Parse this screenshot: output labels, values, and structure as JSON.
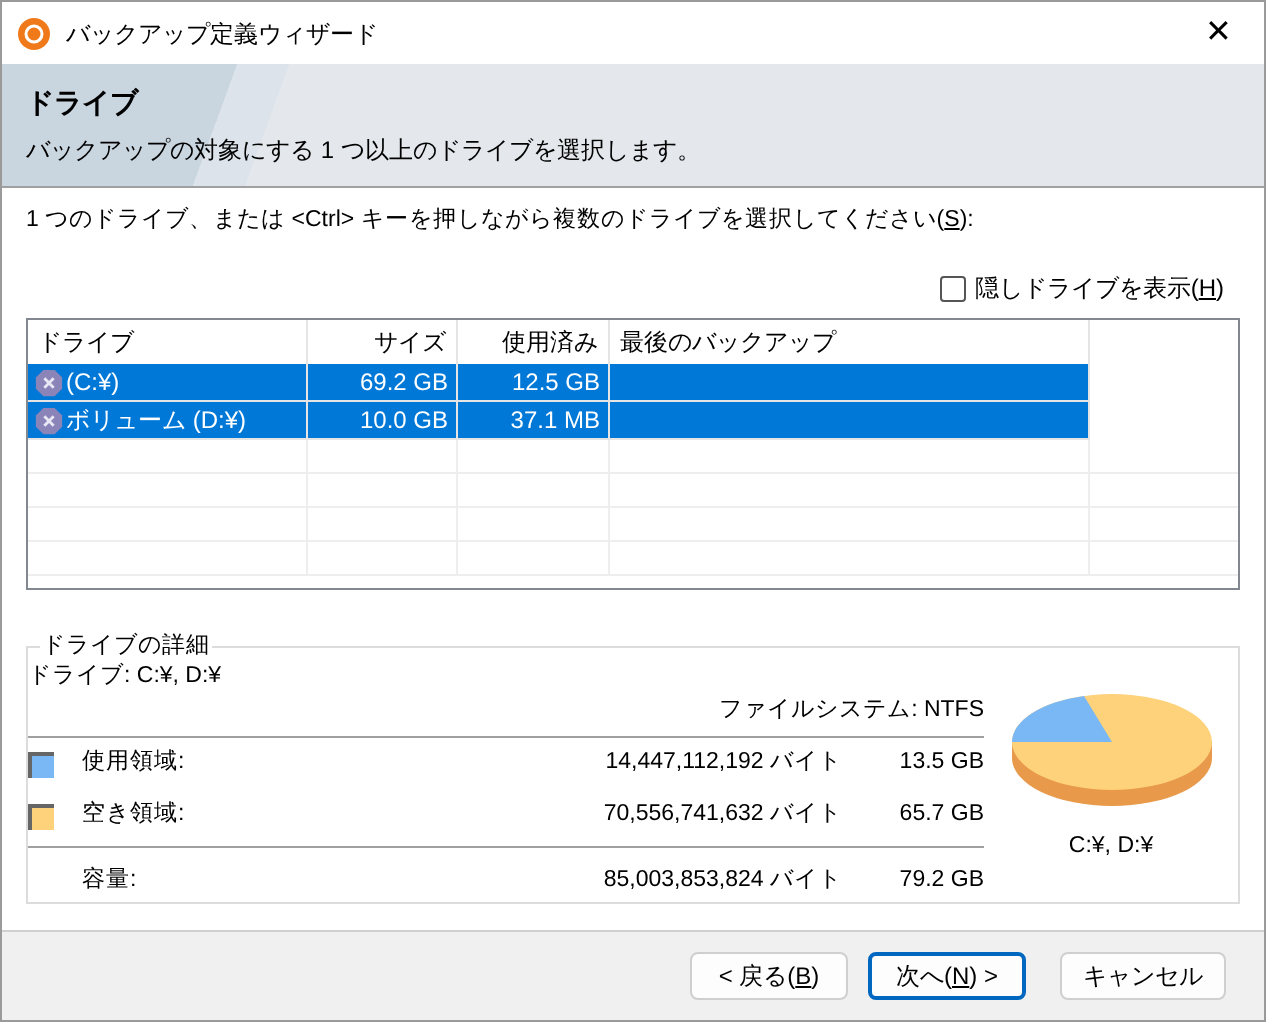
{
  "window": {
    "title": "バックアップ定義ウィザード",
    "close": "✕"
  },
  "header": {
    "title": "ドライブ",
    "subtitle": "バックアップの対象にする 1 つ以上のドライブを選択します。"
  },
  "instruction": {
    "before": "1 つのドライブ、または <Ctrl> キーを押しながら複数のドライブを選択してください(",
    "accel": "S",
    "after": "):"
  },
  "show_hidden": {
    "before": "隠しドライブを表示(",
    "accel": "H",
    "after": ")",
    "checked": false
  },
  "table": {
    "columns": [
      "ドライブ",
      "サイズ",
      "使用済み",
      "最後のバックアップ"
    ],
    "rows": [
      {
        "cells": [
          "(C:¥)",
          "69.2 GB",
          "12.5 GB"
        ],
        "selected": true
      },
      {
        "cells": [
          "ボリューム (D:¥)",
          "10.0 GB",
          "37.1 MB"
        ],
        "selected": true
      }
    ]
  },
  "details": {
    "legend": "ドライブの詳細",
    "drive": "ドライブ: C:¥, D:¥",
    "filesystem": "ファイルシステム: NTFS",
    "items": [
      {
        "label": "使用領域:",
        "bytes": "14,447,112,192 バイト",
        "size": "13.5 GB",
        "color": "#7ab8f5"
      },
      {
        "label": "空き領域:",
        "bytes": "70,556,741,632 バイト",
        "size": "65.7 GB",
        "color": "#fdd27a"
      }
    ],
    "total": {
      "label": "容量:",
      "bytes": "85,003,853,824 バイト",
      "size": "79.2 GB"
    },
    "chart_caption": "C:¥, D:¥"
  },
  "buttons": [
    {
      "before": "< 戻る(",
      "accel": "B",
      "after": ")",
      "selected": false
    },
    {
      "before": "次へ(",
      "accel": "N",
      "after": ") >",
      "selected": true
    },
    {
      "before": "キャンセル",
      "selected": false
    }
  ]
}
